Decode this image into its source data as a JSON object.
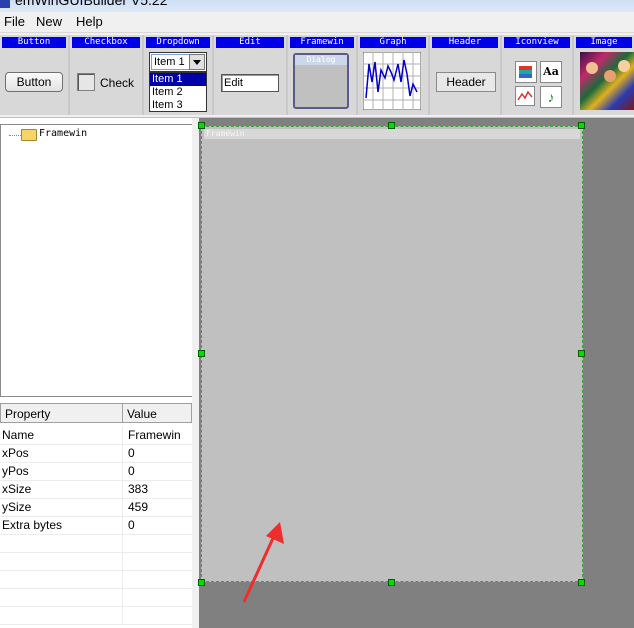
{
  "window": {
    "title": "emWinGUIBuilder V5.22"
  },
  "menu": {
    "items": [
      "File",
      "New",
      "Help"
    ]
  },
  "toolbar": {
    "tools": [
      {
        "name": "Button",
        "sample_label": "Button"
      },
      {
        "name": "Checkbox",
        "sample_label": "Check"
      },
      {
        "name": "Dropdown",
        "selected": "Item 1",
        "options": [
          "Item 1",
          "Item 2",
          "Item 3"
        ]
      },
      {
        "name": "Edit",
        "sample_value": "Edit"
      },
      {
        "name": "Framewin",
        "sample_caption": "Dialog"
      },
      {
        "name": "Graph"
      },
      {
        "name": "Header",
        "sample_label": "Header"
      },
      {
        "name": "Iconview",
        "icon_text": "Aa"
      },
      {
        "name": "Image"
      }
    ]
  },
  "tree": {
    "root": "Framewin"
  },
  "properties": {
    "headers": [
      "Property",
      "Value"
    ],
    "rows": [
      {
        "key": "Name",
        "value": "Framewin"
      },
      {
        "key": "xPos",
        "value": "0"
      },
      {
        "key": "yPos",
        "value": "0"
      },
      {
        "key": "xSize",
        "value": "383"
      },
      {
        "key": "ySize",
        "value": "459"
      },
      {
        "key": "Extra bytes",
        "value": "0"
      }
    ]
  },
  "canvas": {
    "framewin_caption": "Framewin"
  },
  "colors": {
    "caption_blue": "#0000e8",
    "handle_green": "#00e000",
    "canvas_gray": "#808080",
    "framewin_gray": "#c0c0c0",
    "annotation_red": "#ee2d2d"
  }
}
